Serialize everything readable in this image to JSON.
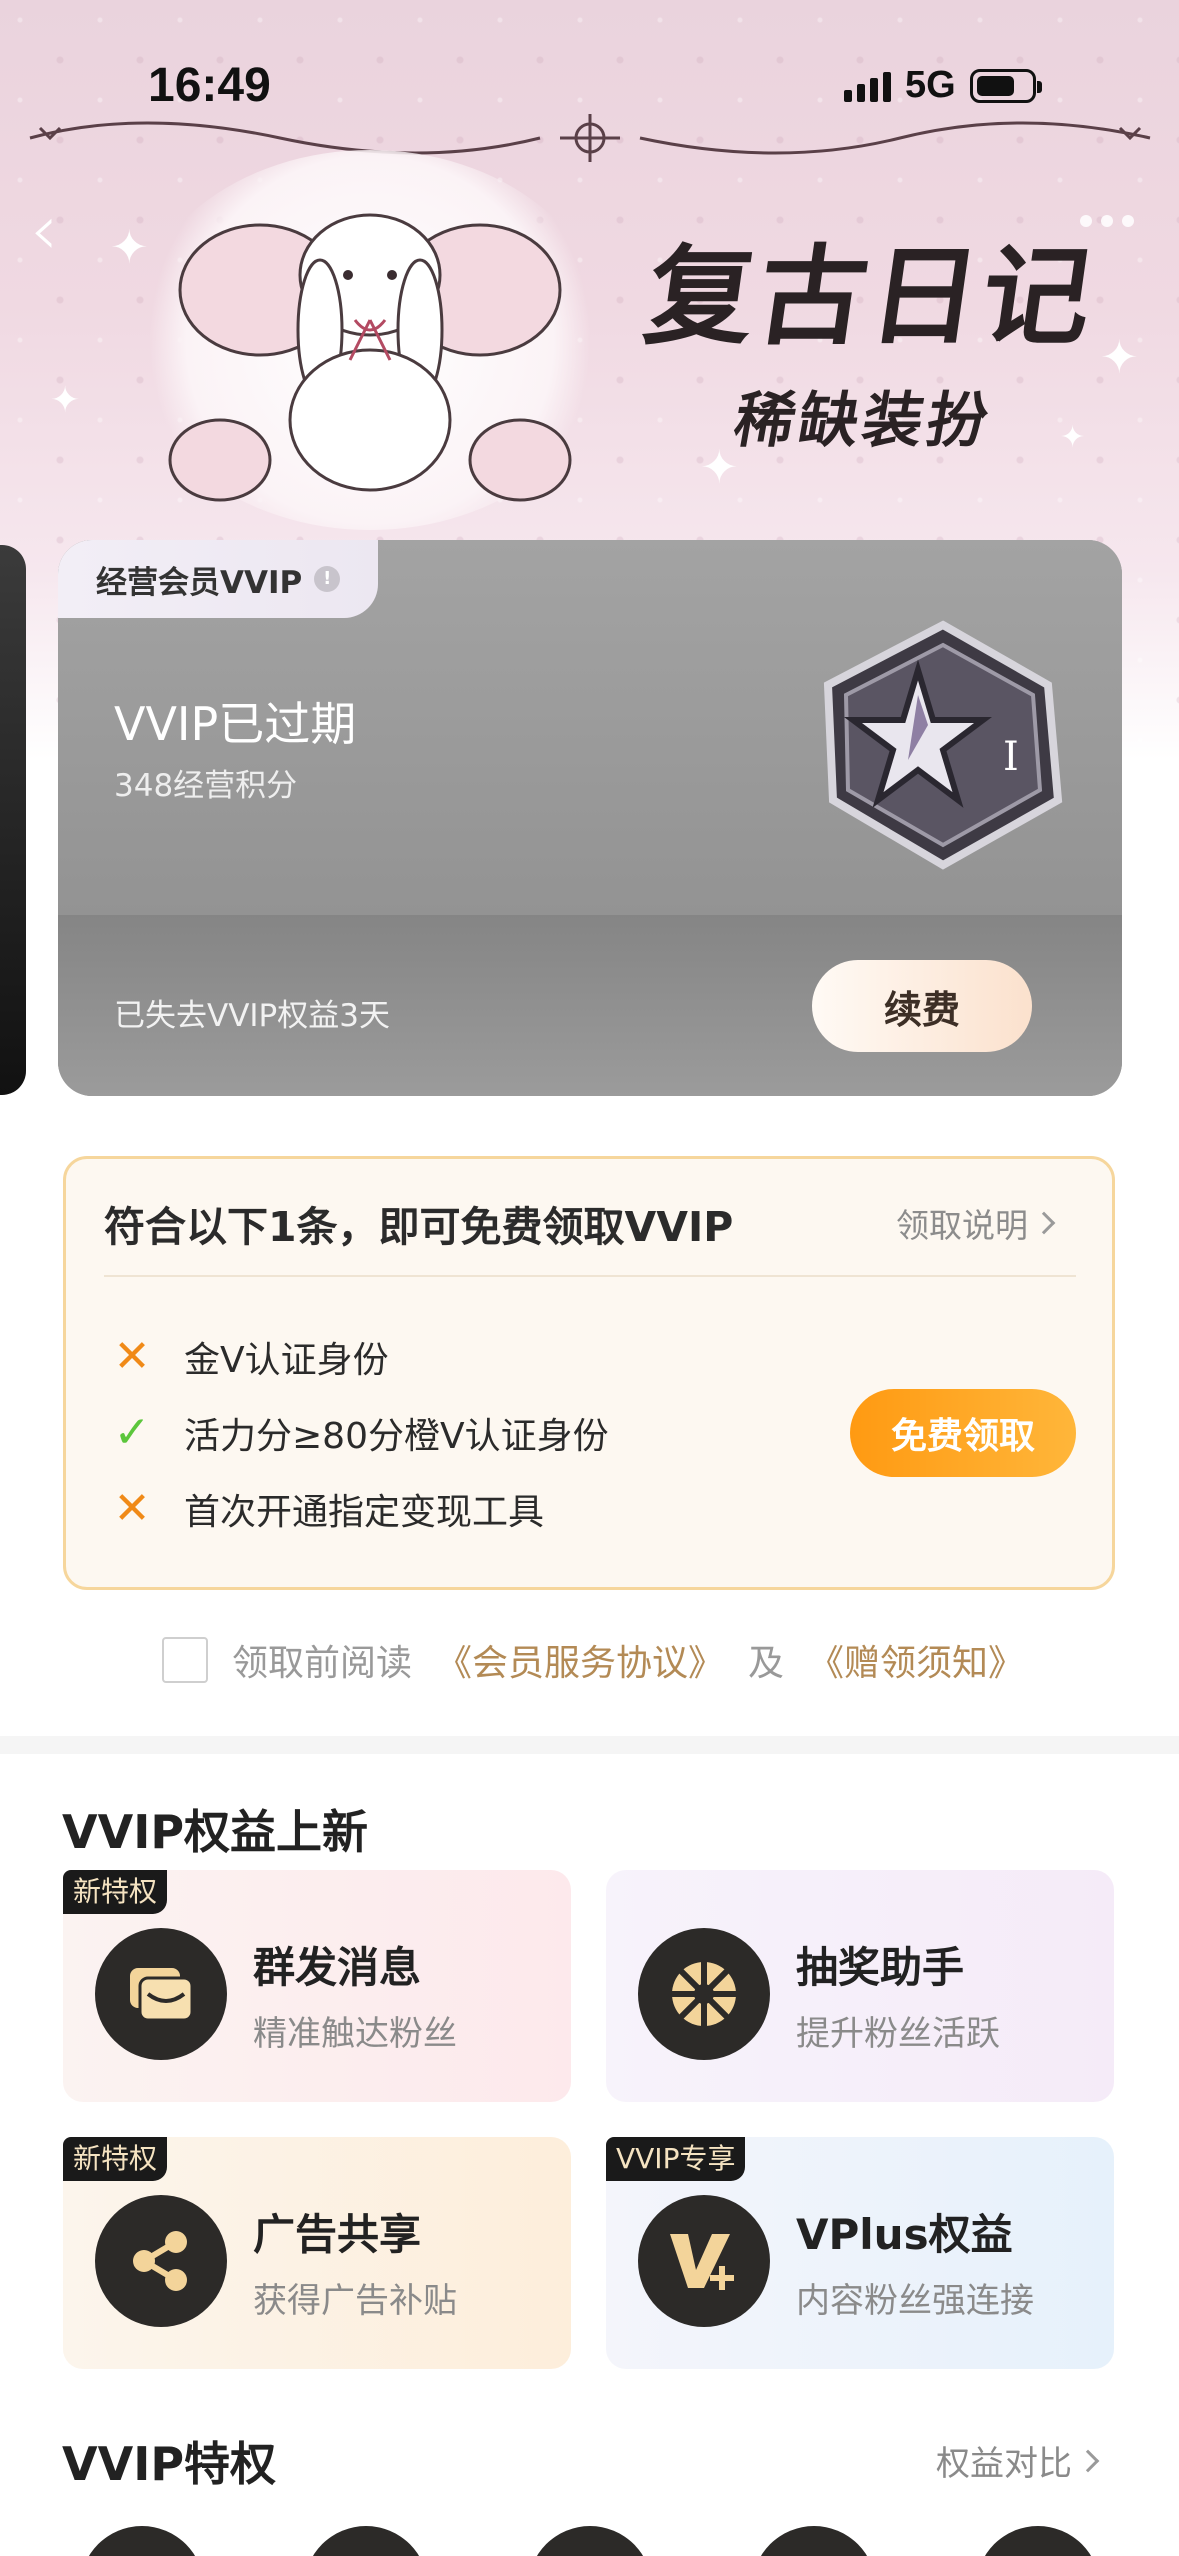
{
  "status_bar": {
    "time": "16:49",
    "network": "5G"
  },
  "banner": {
    "title": "复古日记",
    "subtitle": "稀缺装扮"
  },
  "vip_card": {
    "tab_label": "经营会员VVIP",
    "status": "VVIP已过期",
    "points": "348经营积分",
    "lost_text": "已失去VVIP权益3天",
    "renew_label": "续费",
    "medal_roman": "I"
  },
  "claim": {
    "title": "符合以下1条，即可免费领取VVIP",
    "help_label": "领取说明",
    "conditions": [
      {
        "text": "金V认证身份",
        "met": false
      },
      {
        "text": "活力分≥80分橙V认证身份",
        "met": true
      },
      {
        "text": "首次开通指定变现工具",
        "met": false
      }
    ],
    "button_label": "免费领取"
  },
  "agreement": {
    "prefix": "领取前阅读",
    "link1": "《会员服务协议》",
    "middle": "及",
    "link2": "《赠领须知》"
  },
  "new_rights": {
    "title": "VVIP权益上新",
    "items": [
      {
        "badge": "新特权",
        "name": "群发消息",
        "desc": "精准触达粉丝",
        "icon": "message-icon"
      },
      {
        "badge": "",
        "name": "抽奖助手",
        "desc": "提升粉丝活跃",
        "icon": "lottery-wheel-icon"
      },
      {
        "badge": "新特权",
        "name": "广告共享",
        "desc": "获得广告补贴",
        "icon": "share-icon"
      },
      {
        "badge": "VVIP专享",
        "name": "VPlus权益",
        "desc": "内容粉丝强连接",
        "icon": "vplus-icon"
      }
    ]
  },
  "privileges": {
    "title": "VVIP特权",
    "compare_label": "权益对比"
  },
  "colors": {
    "accent_orange": "#ff9a12",
    "check_green": "#5cc63c",
    "cross_orange": "#f08a18",
    "link_gold": "#b38a55"
  }
}
